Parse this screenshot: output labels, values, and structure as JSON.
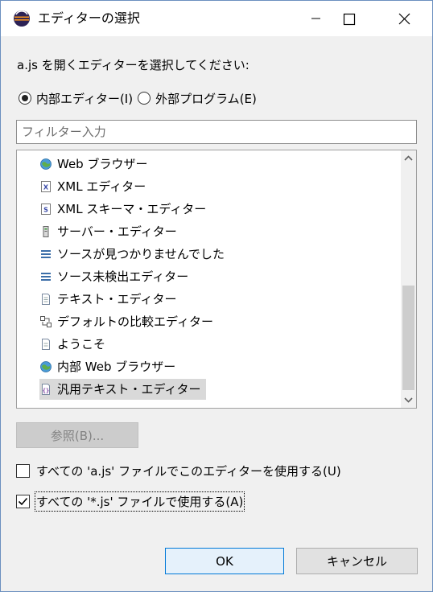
{
  "window": {
    "title": "エディターの選択",
    "app_icon": "eclipse-icon"
  },
  "prompt": "a.js を開くエディターを選択してください:",
  "radios": {
    "internal": {
      "label": "内部エディター(I)",
      "checked": true
    },
    "external": {
      "label": "外部プログラム(E)",
      "checked": false
    }
  },
  "filter": {
    "placeholder": "フィルター入力",
    "value": ""
  },
  "editors": [
    {
      "label": "Web ブラウザー",
      "icon": "globe-icon"
    },
    {
      "label": "XML エディター",
      "icon": "xml-file-icon"
    },
    {
      "label": "XML スキーマ・エディター",
      "icon": "schema-file-icon"
    },
    {
      "label": "サーバー・エディター",
      "icon": "server-icon"
    },
    {
      "label": "ソースが見つかりませんでした",
      "icon": "source-lines-icon"
    },
    {
      "label": "ソース未検出エディター",
      "icon": "source-lines-icon"
    },
    {
      "label": "テキスト・エディター",
      "icon": "text-file-icon"
    },
    {
      "label": "デフォルトの比較エディター",
      "icon": "compare-icon"
    },
    {
      "label": "ようこそ",
      "icon": "document-icon"
    },
    {
      "label": "内部 Web ブラウザー",
      "icon": "globe-icon"
    },
    {
      "label": "汎用テキスト・エディター",
      "icon": "generic-text-editor-icon",
      "selected": true
    }
  ],
  "browse_button": {
    "label": "参照(B)...",
    "enabled": false
  },
  "checkboxes": {
    "use_for_file": {
      "label": "すべての 'a.js' ファイルでこのエディターを使用する(U)",
      "checked": false
    },
    "use_for_ext": {
      "label": "すべての '*.js' ファイルで使用する(A)",
      "checked": true
    }
  },
  "buttons": {
    "ok": "OK",
    "cancel": "キャンセル"
  },
  "colors": {
    "accent": "#0078d7",
    "selection": "#d9d9d9"
  }
}
